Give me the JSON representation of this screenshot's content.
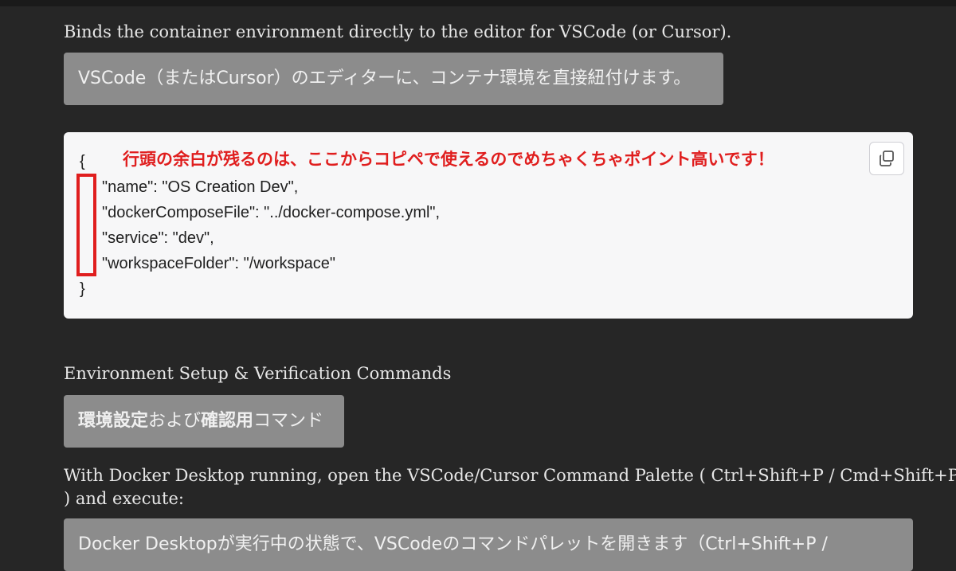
{
  "section1": {
    "heading": "Binds the container environment directly to the editor for VSCode (or Cursor).",
    "translation": "VSCode（またはCursor）のエディターに、コンテナ環境を直接紐付けます。"
  },
  "code_block": {
    "annotation": "行頭の余白が残るのは、ここからコピペで使えるのでめちゃくちゃポイント高いです！",
    "lines": [
      "{",
      "\"name\": \"OS Creation Dev\",",
      "\"dockerComposeFile\": \"../docker-compose.yml\",",
      "\"service\": \"dev\",",
      "\"workspaceFolder\": \"/workspace\"",
      "}"
    ],
    "copy_icon": "copy-icon"
  },
  "section2": {
    "heading": "Environment Setup & Verification Commands",
    "translation_bold_1": "環境設定",
    "translation_normal_1": "および",
    "translation_bold_2": "確認用",
    "translation_normal_2": "コマンド"
  },
  "section3": {
    "paragraph_line1": "With Docker Desktop running, open the VSCode/Cursor Command Palette ( Ctrl+Shift+P / Cmd+Shift+P",
    "paragraph_line2": ") and execute:",
    "translation": "Docker Desktopが実行中の状態で、VSCodeのコマンドパレットを開きます（Ctrl+Shift+P /"
  },
  "colors": {
    "background": "#262626",
    "annotation_red": "#e01e1e",
    "translation_box": "#8c8c8c",
    "code_card": "#f7f7f8"
  }
}
